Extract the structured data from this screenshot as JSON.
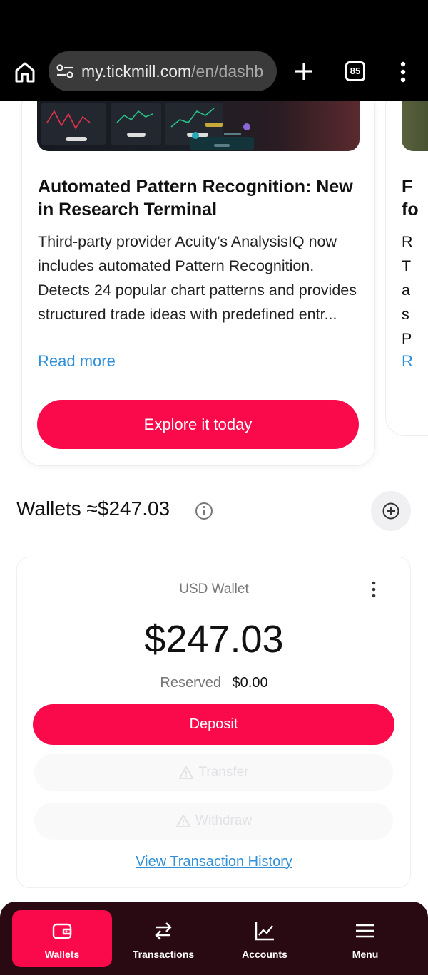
{
  "browser": {
    "url_main": "my.tickmill.com",
    "url_path": "/en/dashb",
    "tab_count": "85"
  },
  "carousel": {
    "card": {
      "title": "Automated Pattern Recognition: New in Research Terminal",
      "description": "Third-party provider Acuity’s AnalysisIQ now includes automated Pattern Recognition. Detects 24 popular chart patterns and provides structured trade ideas with predefined entr...",
      "read_more": "Read more",
      "cta": "Explore it today"
    },
    "next_card_partial": {
      "title_lines": [
        "F",
        "fo"
      ],
      "desc_lines": [
        "R",
        "T",
        "a",
        "s",
        "P"
      ],
      "read_more": "R"
    }
  },
  "wallets": {
    "title": "Wallets ≈$247.03",
    "wallet": {
      "name": "USD Wallet",
      "balance": "$247.03",
      "reserved_label": "Reserved",
      "reserved_value": "$0.00",
      "deposit_label": "Deposit",
      "transfer_label": "Transfer",
      "withdraw_label": "Withdraw",
      "history_link": "View Transaction History"
    }
  },
  "bottom_nav": {
    "items": [
      {
        "label": "Wallets",
        "icon": "wallet-icon",
        "active": true
      },
      {
        "label": "Transactions",
        "icon": "arrows-swap-icon",
        "active": false
      },
      {
        "label": "Accounts",
        "icon": "chart-line-icon",
        "active": false
      },
      {
        "label": "Menu",
        "icon": "hamburger-icon",
        "active": false
      }
    ]
  },
  "colors": {
    "brand": "#fa0a4a",
    "link": "#2f8fd8",
    "nav_bg": "#2a0a12"
  }
}
